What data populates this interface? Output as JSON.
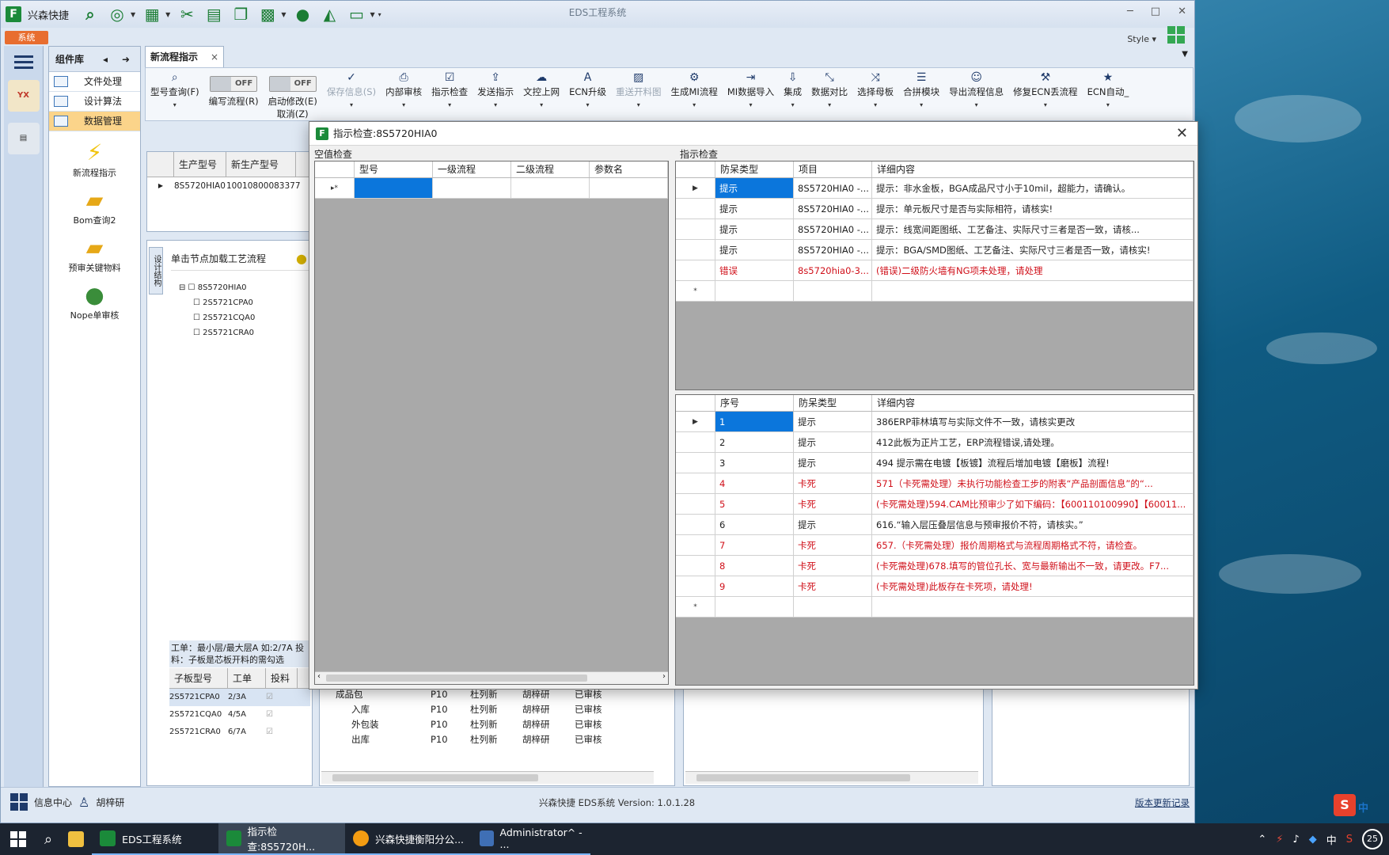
{
  "window": {
    "title": "EDS工程系统",
    "app_name": "兴森快捷"
  },
  "sysbar": {
    "system_tab": "系统",
    "style_label": "Style"
  },
  "nav": {
    "yx_label": "YX"
  },
  "panel": {
    "title": "组件库",
    "menu": [
      "文件处理",
      "设计算法",
      "数据管理"
    ],
    "tiles": [
      "新流程指示",
      "Bom查询2",
      "预审关键物料",
      "Nope单审核"
    ]
  },
  "doc_tab": {
    "label": "新流程指示",
    "close": "×"
  },
  "ribbon": [
    {
      "label": "型号查询(F)",
      "icon": "search-icon"
    },
    {
      "label": "编写流程(R)",
      "toggle": "OFF"
    },
    {
      "label": "启动修改(E)",
      "sub": "取消(Z)",
      "toggle": "OFF"
    },
    {
      "label": "保存信息(S)",
      "icon": "check-icon",
      "disabled": true
    },
    {
      "label": "内部审核",
      "icon": "print-icon"
    },
    {
      "label": "指示检查",
      "icon": "checkbox-icon"
    },
    {
      "label": "发送指示",
      "icon": "upload-icon"
    },
    {
      "label": "文控上网",
      "icon": "cloud-upload-icon"
    },
    {
      "label": "ECN升级",
      "icon": "font-icon"
    },
    {
      "label": "重送开料图",
      "icon": "image-icon",
      "disabled": true
    },
    {
      "label": "生成MI流程",
      "icon": "cogs-icon"
    },
    {
      "label": "MI数据导入",
      "icon": "sign-in-icon"
    },
    {
      "label": "集成",
      "icon": "download-icon"
    },
    {
      "label": "数据对比",
      "icon": "compress-icon"
    },
    {
      "label": "选择母板",
      "icon": "shuffle-icon"
    },
    {
      "label": "合拼模块",
      "icon": "list-icon"
    },
    {
      "label": "导出流程信息",
      "icon": "smile-icon"
    },
    {
      "label": "修复ECN丢流程",
      "icon": "wrench-icon"
    },
    {
      "label": "ECN自动_",
      "icon": "star-icon"
    }
  ],
  "model_grid": {
    "headers": [
      "生产型号",
      "新生产型号"
    ],
    "rows": [
      [
        "8S5720HIA0",
        "10010800083377"
      ]
    ]
  },
  "process_panel": {
    "vertical_label": "设计结构",
    "hint": "单击节点加载工艺流程",
    "tree_root": "8S5720HIA0",
    "tree_children": [
      "2S5721CPA0",
      "2S5721CQA0",
      "2S5721CRA0"
    ],
    "note": "工单：最小层/最大层A 如:2/7A 投料：子板是芯板开料的需勾选",
    "sub_headers": [
      "子板型号",
      "工单",
      "投料"
    ],
    "sub_rows": [
      [
        "2S5721CPA0",
        "2/3A"
      ],
      [
        "2S5721CQA0",
        "4/5A"
      ],
      [
        "2S5721CRA0",
        "6/7A"
      ]
    ]
  },
  "bottom_tree": {
    "rows": [
      [
        "成品包",
        "P10",
        "杜列新",
        "胡梓研",
        "已审核"
      ],
      [
        "入库",
        "P10",
        "杜列新",
        "胡梓研",
        "已审核"
      ],
      [
        "外包装",
        "P10",
        "杜列新",
        "胡梓研",
        "已审核"
      ],
      [
        "出库",
        "P10",
        "杜列新",
        "胡梓研",
        "已审核"
      ]
    ]
  },
  "status": {
    "info_center": "信息中心",
    "user": "胡梓研",
    "center": "兴森快捷 EDS系统 Version: 1.0.1.28",
    "right": "版本更新记录"
  },
  "dialog": {
    "title": "指示检查:8S5720HIA0",
    "close": "✕",
    "left_title": "空值检查",
    "left_headers": [
      "型号",
      "一级流程",
      "二级流程",
      "参数名"
    ],
    "left_new_row": "▸*",
    "right_title": "指示检查",
    "top_headers": [
      "防呆类型",
      "项目",
      "详细内容"
    ],
    "top_rows": [
      {
        "type": "提示",
        "item": "8S5720HIA0 -...",
        "detail": "提示：非水金板，BGA成品尺寸小于10mil，超能力，请确认。",
        "red": false
      },
      {
        "type": "提示",
        "item": "8S5720HIA0 -...",
        "detail": "提示：单元板尺寸是否与实际相符，请核实!",
        "red": false
      },
      {
        "type": "提示",
        "item": "8S5720HIA0 -...",
        "detail": "提示：线宽间距图纸、工艺备注、实际尺寸三者是否一致，请核...",
        "red": false
      },
      {
        "type": "提示",
        "item": "8S5720HIA0 -...",
        "detail": "提示：BGA/SMD图纸、工艺备注、实际尺寸三者是否一致，请核实!",
        "red": false
      },
      {
        "type": "错误",
        "item": "8s5720hia0-3...",
        "detail": "(错误)二级防火墙有NG项未处理，请处理",
        "red": true
      }
    ],
    "bottom_headers": [
      "序号",
      "防呆类型",
      "详细内容"
    ],
    "bottom_rows": [
      {
        "no": "1",
        "type": "提示",
        "detail": "386ERP菲林填写与实际文件不一致，请核实更改",
        "red": false
      },
      {
        "no": "2",
        "type": "提示",
        "detail": "412此板为正片工艺，ERP流程错误,请处理。",
        "red": false
      },
      {
        "no": "3",
        "type": "提示",
        "detail": "494 提示需在电镀【板镀】流程后增加电镀【磨板】流程!",
        "red": false
      },
      {
        "no": "4",
        "type": "卡死",
        "detail": "571（卡死需处理）未执行功能检查工步的附表“产品剖面信息”的“...",
        "red": true
      },
      {
        "no": "5",
        "type": "卡死",
        "detail": "(卡死需处理)594.CAM比预审少了如下编码：【600110100990】【60011...",
        "red": true
      },
      {
        "no": "6",
        "type": "提示",
        "detail": "616.“输入层压叠层信息与预审报价不符，请核实。”",
        "red": false
      },
      {
        "no": "7",
        "type": "卡死",
        "detail": "657.（卡死需处理）报价周期格式与流程周期格式不符，请检查。",
        "red": true
      },
      {
        "no": "8",
        "type": "卡死",
        "detail": "(卡死需处理)678.填写的管位孔长、宽与最新输出不一致，请更改。F7...",
        "red": true
      },
      {
        "no": "9",
        "type": "卡死",
        "detail": "(卡死需处理)此板存在卡死项，请处理!",
        "red": true
      }
    ]
  },
  "taskbar": {
    "items": [
      "EDS工程系统",
      "指示检查:8S5720H...",
      "兴森快捷衡阳分公...",
      "Administrator^ - ..."
    ],
    "tray_ime": "中",
    "notif_count": "25"
  }
}
